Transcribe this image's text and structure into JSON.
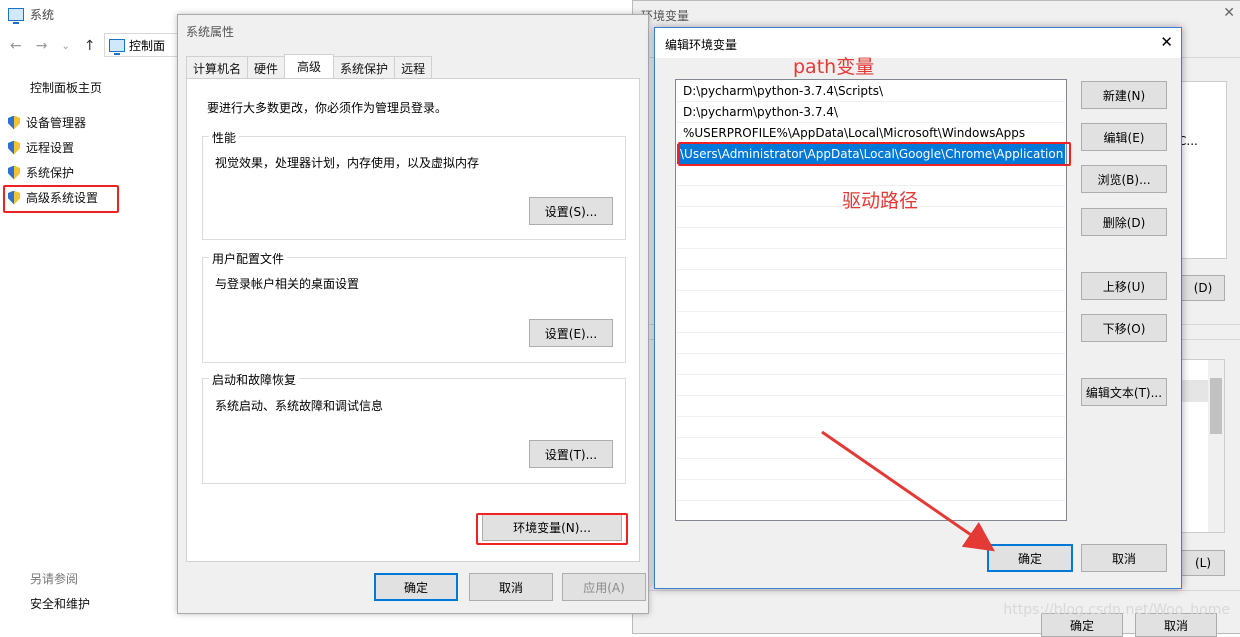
{
  "control_panel": {
    "window_title": "系统",
    "address_text": "控制面",
    "home_link": "控制面板主页",
    "items": [
      {
        "label": "设备管理器"
      },
      {
        "label": "远程设置"
      },
      {
        "label": "系统保护"
      },
      {
        "label": "高级系统设置"
      }
    ],
    "see_also": "另请参阅",
    "security_maintenance": "安全和维护"
  },
  "system_properties": {
    "title": "系统属性",
    "tabs": [
      "计算机名",
      "硬件",
      "高级",
      "系统保护",
      "远程"
    ],
    "active_tab": "高级",
    "admin_note": "要进行大多数更改，你必须作为管理员登录。",
    "performance": {
      "title": "性能",
      "desc": "视觉效果，处理器计划，内存使用，以及虚拟内存",
      "button": "设置(S)..."
    },
    "user_profiles": {
      "title": "用户配置文件",
      "desc": "与登录帐户相关的桌面设置",
      "button": "设置(E)..."
    },
    "startup_recovery": {
      "title": "启动和故障恢复",
      "desc": "系统启动、系统故障和调试信息",
      "button": "设置(T)..."
    },
    "env_button": "环境变量(N)...",
    "ok": "确定",
    "cancel": "取消",
    "apply": "应用(A)"
  },
  "env_vars_window": {
    "title": "环境变量",
    "partial_c": "C...",
    "partial_d": "(D)",
    "partial_l": "(L)",
    "ok": "确定",
    "cancel": "取消"
  },
  "edit_env": {
    "title": "编辑环境变量",
    "entries": [
      "D:\\pycharm\\python-3.7.4\\Scripts\\",
      "D:\\pycharm\\python-3.7.4\\",
      "%USERPROFILE%\\AppData\\Local\\Microsoft\\WindowsApps",
      "\\Users\\Administrator\\AppData\\Local\\Google\\Chrome\\Application"
    ],
    "selected_index": 3,
    "buttons": {
      "new": "新建(N)",
      "edit": "编辑(E)",
      "browse": "浏览(B)...",
      "delete": "删除(D)",
      "move_up": "上移(U)",
      "move_down": "下移(O)",
      "edit_text": "编辑文本(T)...",
      "ok": "确定",
      "cancel": "取消"
    }
  },
  "annotations": {
    "path_label": "path变量",
    "driver_label": "驱动路径",
    "color": "#e53935"
  },
  "watermark": "https://blog.csdn.net/Woo_home"
}
